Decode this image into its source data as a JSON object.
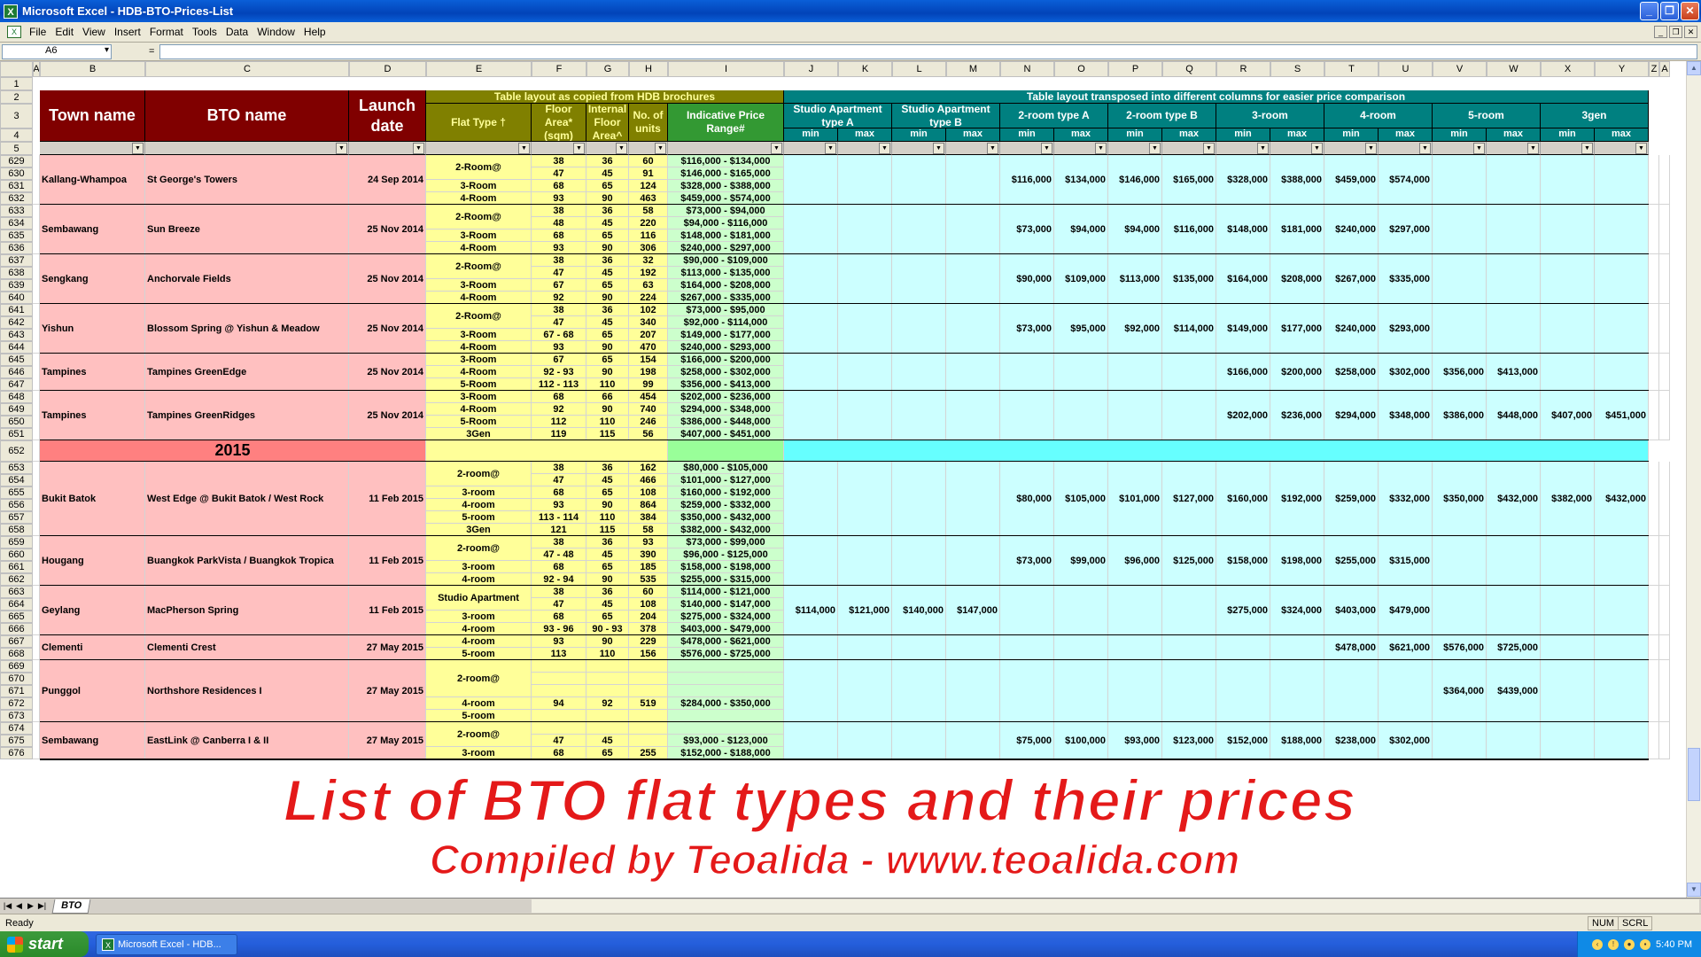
{
  "window": {
    "title": "Microsoft Excel - HDB-BTO-Prices-List",
    "app_icon": "excel-icon"
  },
  "menu": [
    "File",
    "Edit",
    "View",
    "Insert",
    "Format",
    "Tools",
    "Data",
    "Window",
    "Help"
  ],
  "formula_bar": {
    "name_box": "A6",
    "fx": "=",
    "content": ""
  },
  "columns": [
    "A",
    "B",
    "C",
    "D",
    "E",
    "F",
    "G",
    "H",
    "I",
    "J",
    "K",
    "L",
    "M",
    "N",
    "O",
    "P",
    "Q",
    "R",
    "S",
    "T",
    "U",
    "V",
    "W",
    "X",
    "Y",
    "Z",
    "A"
  ],
  "header": {
    "town": "Town name",
    "bto": "BTO name",
    "launch": "Launch date",
    "group_left": "Table layout as copied from HDB brochures",
    "group_right": "Table layout transposed into different columns for easier price comparison",
    "flat_type": "Flat Type †",
    "floor_area": "Floor Area* (sqm)",
    "internal_area": "Internal Floor Area^",
    "units": "No. of units",
    "price_range": "Indicative Price Range#",
    "types": [
      "Studio Apartment type A",
      "Studio Apartment type B",
      "2-room type A",
      "2-room type B",
      "3-room",
      "4-room",
      "5-room",
      "3gen"
    ],
    "min": "min",
    "max": "max"
  },
  "row_numbers_top": [
    "1",
    "2",
    "3",
    "4",
    "5"
  ],
  "year_row": {
    "row": "652",
    "label": "2015"
  },
  "groups": [
    {
      "town": "Kallang-Whampoa",
      "bto": "St George's Towers",
      "date": "24 Sep 2014",
      "rows": [
        {
          "n": "629",
          "ft": "2-Room@",
          "f": "38",
          "g": "36",
          "h": "60",
          "i": "$116,000 - $134,000"
        },
        {
          "n": "630",
          "ft": "",
          "f": "47",
          "g": "45",
          "h": "91",
          "i": "$146,000 - $165,000"
        },
        {
          "n": "631",
          "ft": "3-Room",
          "f": "68",
          "g": "65",
          "h": "124",
          "i": "$328,000 - $388,000"
        },
        {
          "n": "632",
          "ft": "4-Room",
          "f": "93",
          "g": "90",
          "h": "463",
          "i": "$459,000 - $574,000"
        }
      ],
      "prices": [
        "",
        "",
        "",
        "",
        "$116,000",
        "$134,000",
        "$146,000",
        "$165,000",
        "$328,000",
        "$388,000",
        "$459,000",
        "$574,000",
        "",
        "",
        "",
        ""
      ]
    },
    {
      "town": "Sembawang",
      "bto": "Sun Breeze",
      "date": "25 Nov 2014",
      "rows": [
        {
          "n": "633",
          "ft": "2-Room@",
          "f": "38",
          "g": "36",
          "h": "58",
          "i": "$73,000 - $94,000"
        },
        {
          "n": "634",
          "ft": "",
          "f": "48",
          "g": "45",
          "h": "220",
          "i": "$94,000 - $116,000"
        },
        {
          "n": "635",
          "ft": "3-Room",
          "f": "68",
          "g": "65",
          "h": "116",
          "i": "$148,000 - $181,000"
        },
        {
          "n": "636",
          "ft": "4-Room",
          "f": "93",
          "g": "90",
          "h": "306",
          "i": "$240,000 - $297,000"
        }
      ],
      "prices": [
        "",
        "",
        "",
        "",
        "$73,000",
        "$94,000",
        "$94,000",
        "$116,000",
        "$148,000",
        "$181,000",
        "$240,000",
        "$297,000",
        "",
        "",
        "",
        ""
      ]
    },
    {
      "town": "Sengkang",
      "bto": "Anchorvale Fields",
      "date": "25 Nov 2014",
      "rows": [
        {
          "n": "637",
          "ft": "2-Room@",
          "f": "38",
          "g": "36",
          "h": "32",
          "i": "$90,000 - $109,000"
        },
        {
          "n": "638",
          "ft": "",
          "f": "47",
          "g": "45",
          "h": "192",
          "i": "$113,000 - $135,000"
        },
        {
          "n": "639",
          "ft": "3-Room",
          "f": "67",
          "g": "65",
          "h": "63",
          "i": "$164,000 - $208,000"
        },
        {
          "n": "640",
          "ft": "4-Room",
          "f": "92",
          "g": "90",
          "h": "224",
          "i": "$267,000 - $335,000"
        }
      ],
      "prices": [
        "",
        "",
        "",
        "",
        "$90,000",
        "$109,000",
        "$113,000",
        "$135,000",
        "$164,000",
        "$208,000",
        "$267,000",
        "$335,000",
        "",
        "",
        "",
        ""
      ]
    },
    {
      "town": "Yishun",
      "bto": "Blossom Spring @ Yishun & Meadow",
      "date": "25 Nov 2014",
      "rows": [
        {
          "n": "641",
          "ft": "2-Room@",
          "f": "38",
          "g": "36",
          "h": "102",
          "i": "$73,000 - $95,000"
        },
        {
          "n": "642",
          "ft": "",
          "f": "47",
          "g": "45",
          "h": "340",
          "i": "$92,000 - $114,000"
        },
        {
          "n": "643",
          "ft": "3-Room",
          "f": "67 - 68",
          "g": "65",
          "h": "207",
          "i": "$149,000 - $177,000"
        },
        {
          "n": "644",
          "ft": "4-Room",
          "f": "93",
          "g": "90",
          "h": "470",
          "i": "$240,000 - $293,000"
        }
      ],
      "prices": [
        "",
        "",
        "",
        "",
        "$73,000",
        "$95,000",
        "$92,000",
        "$114,000",
        "$149,000",
        "$177,000",
        "$240,000",
        "$293,000",
        "",
        "",
        "",
        ""
      ]
    },
    {
      "town": "Tampines",
      "bto": "Tampines GreenEdge",
      "date": "25 Nov 2014",
      "rows": [
        {
          "n": "645",
          "ft": "3-Room",
          "f": "67",
          "g": "65",
          "h": "154",
          "i": "$166,000 - $200,000"
        },
        {
          "n": "646",
          "ft": "4-Room",
          "f": "92 - 93",
          "g": "90",
          "h": "198",
          "i": "$258,000 - $302,000"
        },
        {
          "n": "647",
          "ft": "5-Room",
          "f": "112 - 113",
          "g": "110",
          "h": "99",
          "i": "$356,000 - $413,000"
        }
      ],
      "prices": [
        "",
        "",
        "",
        "",
        "",
        "",
        "",
        "",
        "$166,000",
        "$200,000",
        "$258,000",
        "$302,000",
        "$356,000",
        "$413,000",
        "",
        ""
      ]
    },
    {
      "town": "Tampines",
      "bto": "Tampines GreenRidges",
      "date": "25 Nov 2014",
      "rows": [
        {
          "n": "648",
          "ft": "3-Room",
          "f": "68",
          "g": "66",
          "h": "454",
          "i": "$202,000 - $236,000"
        },
        {
          "n": "649",
          "ft": "4-Room",
          "f": "92",
          "g": "90",
          "h": "740",
          "i": "$294,000 - $348,000"
        },
        {
          "n": "650",
          "ft": "5-Room",
          "f": "112",
          "g": "110",
          "h": "246",
          "i": "$386,000 - $448,000"
        },
        {
          "n": "651",
          "ft": "3Gen",
          "f": "119",
          "g": "115",
          "h": "56",
          "i": "$407,000 - $451,000"
        }
      ],
      "prices": [
        "",
        "",
        "",
        "",
        "",
        "",
        "",
        "",
        "$202,000",
        "$236,000",
        "$294,000",
        "$348,000",
        "$386,000",
        "$448,000",
        "$407,000",
        "$451,000"
      ]
    },
    {
      "town": "Bukit Batok",
      "bto": "West Edge @ Bukit Batok / West Rock",
      "date": "11 Feb 2015",
      "rows": [
        {
          "n": "653",
          "ft": "2-room@",
          "f": "38",
          "g": "36",
          "h": "162",
          "i": "$80,000 - $105,000"
        },
        {
          "n": "654",
          "ft": "",
          "f": "47",
          "g": "45",
          "h": "466",
          "i": "$101,000 - $127,000"
        },
        {
          "n": "655",
          "ft": "3-room",
          "f": "68",
          "g": "65",
          "h": "108",
          "i": "$160,000 - $192,000"
        },
        {
          "n": "656",
          "ft": "4-room",
          "f": "93",
          "g": "90",
          "h": "864",
          "i": "$259,000 - $332,000"
        },
        {
          "n": "657",
          "ft": "5-room",
          "f": "113 - 114",
          "g": "110",
          "h": "384",
          "i": "$350,000 - $432,000"
        },
        {
          "n": "658",
          "ft": "3Gen",
          "f": "121",
          "g": "115",
          "h": "58",
          "i": "$382,000 - $432,000"
        }
      ],
      "prices": [
        "",
        "",
        "",
        "",
        "$80,000",
        "$105,000",
        "$101,000",
        "$127,000",
        "$160,000",
        "$192,000",
        "$259,000",
        "$332,000",
        "$350,000",
        "$432,000",
        "$382,000",
        "$432,000"
      ]
    },
    {
      "town": "Hougang",
      "bto": "Buangkok ParkVista / Buangkok Tropica",
      "date": "11 Feb 2015",
      "rows": [
        {
          "n": "659",
          "ft": "2-room@",
          "f": "38",
          "g": "36",
          "h": "93",
          "i": "$73,000 - $99,000"
        },
        {
          "n": "660",
          "ft": "",
          "f": "47 - 48",
          "g": "45",
          "h": "390",
          "i": "$96,000 - $125,000"
        },
        {
          "n": "661",
          "ft": "3-room",
          "f": "68",
          "g": "65",
          "h": "185",
          "i": "$158,000 - $198,000"
        },
        {
          "n": "662",
          "ft": "4-room",
          "f": "92 - 94",
          "g": "90",
          "h": "535",
          "i": "$255,000 - $315,000"
        }
      ],
      "prices": [
        "",
        "",
        "",
        "",
        "$73,000",
        "$99,000",
        "$96,000",
        "$125,000",
        "$158,000",
        "$198,000",
        "$255,000",
        "$315,000",
        "",
        "",
        "",
        ""
      ]
    },
    {
      "town": "Geylang",
      "bto": "MacPherson Spring",
      "date": "11 Feb 2015",
      "rows": [
        {
          "n": "663",
          "ft": "Studio Apartment",
          "f": "38",
          "g": "36",
          "h": "60",
          "i": "$114,000 - $121,000"
        },
        {
          "n": "664",
          "ft": "",
          "f": "47",
          "g": "45",
          "h": "108",
          "i": "$140,000 - $147,000"
        },
        {
          "n": "665",
          "ft": "3-room",
          "f": "68",
          "g": "65",
          "h": "204",
          "i": "$275,000 - $324,000"
        },
        {
          "n": "666",
          "ft": "4-room",
          "f": "93 - 96",
          "g": "90 - 93",
          "h": "378",
          "i": "$403,000 - $479,000"
        }
      ],
      "prices": [
        "$114,000",
        "$121,000",
        "$140,000",
        "$147,000",
        "",
        "",
        "",
        "",
        "$275,000",
        "$324,000",
        "$403,000",
        "$479,000",
        "",
        "",
        "",
        ""
      ]
    },
    {
      "town": "Clementi",
      "bto": "Clementi Crest",
      "date": "27 May 2015",
      "rows": [
        {
          "n": "667",
          "ft": "4-room",
          "f": "93",
          "g": "90",
          "h": "229",
          "i": "$478,000 - $621,000"
        },
        {
          "n": "668",
          "ft": "5-room",
          "f": "113",
          "g": "110",
          "h": "156",
          "i": "$576,000 - $725,000"
        }
      ],
      "prices": [
        "",
        "",
        "",
        "",
        "",
        "",
        "",
        "",
        "",
        "",
        "$478,000",
        "$621,000",
        "$576,000",
        "$725,000",
        "",
        ""
      ]
    },
    {
      "town": "Punggol",
      "bto": "Northshore Residences I",
      "date": "27 May 2015",
      "rows": [
        {
          "n": "669",
          "ft": "2-room@",
          "f": "",
          "g": "",
          "h": "",
          "i": ""
        },
        {
          "n": "670",
          "ft": "",
          "f": "",
          "g": "",
          "h": "",
          "i": ""
        },
        {
          "n": "671",
          "ft": "",
          "f": "",
          "g": "",
          "h": "",
          "i": ""
        },
        {
          "n": "672",
          "ft": "4-room",
          "f": "94",
          "g": "92",
          "h": "519",
          "i": "$284,000 - $350,000"
        },
        {
          "n": "673",
          "ft": "5-room",
          "f": "",
          "g": "",
          "h": "",
          "i": ""
        }
      ],
      "prices": [
        "",
        "",
        "",
        "",
        "",
        "",
        "",
        "",
        "",
        "",
        "",
        "",
        "$364,000",
        "$439,000",
        "",
        ""
      ]
    },
    {
      "town": "Sembawang",
      "bto": "EastLink @ Canberra I & II",
      "date": "27 May 2015",
      "rows": [
        {
          "n": "674",
          "ft": "2-room@",
          "f": "",
          "g": "",
          "h": "",
          "i": ""
        },
        {
          "n": "675",
          "ft": "",
          "f": "47",
          "g": "45",
          "h": "",
          "i": "$93,000 - $123,000"
        },
        {
          "n": "676",
          "ft": "3-room",
          "f": "68",
          "g": "65",
          "h": "255",
          "i": "$152,000 - $188,000"
        }
      ],
      "prices": [
        "",
        "",
        "",
        "",
        "$75,000",
        "$100,000",
        "$93,000",
        "$123,000",
        "$152,000",
        "$188,000",
        "$238,000",
        "$302,000",
        "",
        "",
        "",
        ""
      ]
    }
  ],
  "overlay": {
    "title": "List of BTO flat types and their prices",
    "subtitle": "Compiled by Teoalida - www.teoalida.com"
  },
  "sheet_tab": "BTO",
  "status": {
    "ready": "Ready",
    "num": "NUM",
    "scrl": "SCRL"
  },
  "taskbar": {
    "start": "start",
    "task": "Microsoft Excel - HDB...",
    "clock": "5:40 PM"
  },
  "colors": {
    "maroon": "#800000",
    "olive": "#808000",
    "teal": "#008080",
    "pink": "#ffc0c0",
    "lightyellow": "#ffff99",
    "lightgreen": "#ccffcc",
    "lightcyan": "#ccffff"
  }
}
